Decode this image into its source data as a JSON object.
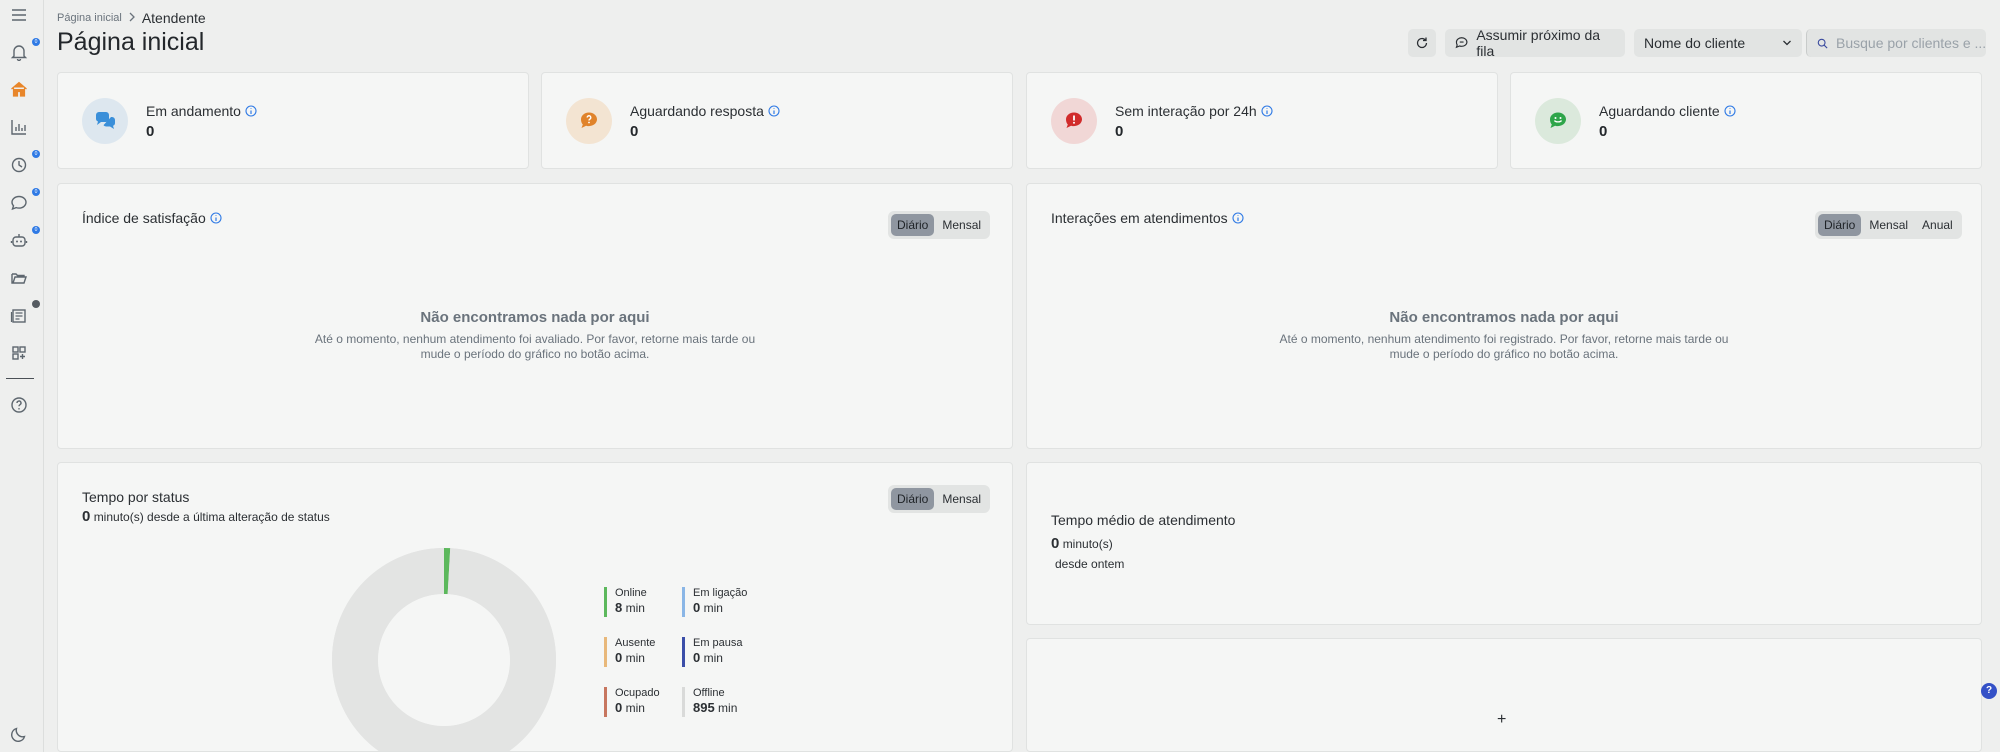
{
  "sidebar": {
    "items": [
      {
        "icon": "menu-icon"
      },
      {
        "icon": "bell-icon",
        "badge": "0"
      },
      {
        "icon": "home-icon",
        "active": true
      },
      {
        "icon": "chart-icon"
      },
      {
        "icon": "clock-icon",
        "badge": "0"
      },
      {
        "icon": "chat-icon",
        "badge": "0"
      },
      {
        "icon": "bot-icon",
        "badge": "0"
      },
      {
        "icon": "folder-icon"
      },
      {
        "icon": "news-icon"
      },
      {
        "icon": "apps-icon"
      },
      {
        "icon": "help-icon"
      },
      {
        "icon": "moon-icon"
      }
    ]
  },
  "breadcrumb": {
    "home": "Página inicial",
    "current": "Atendente"
  },
  "page_title": "Página inicial",
  "actions": {
    "next_in_queue": "Assumir próximo da fila",
    "filter_selected": "Nome do cliente",
    "search_placeholder": "Busque por clientes e ..."
  },
  "stats": [
    {
      "label": "Em andamento",
      "value": "0",
      "icon": "chat-bubbles-icon",
      "color": "#3a8fd9",
      "bg": "#dde7ef"
    },
    {
      "label": "Aguardando resposta",
      "value": "0",
      "icon": "question-bubble-icon",
      "color": "#e0832b",
      "bg": "#f3e4d2"
    },
    {
      "label": "Sem interação por 24h",
      "value": "0",
      "icon": "alert-bubble-icon",
      "color": "#d12b2b",
      "bg": "#f1d7d6"
    },
    {
      "label": "Aguardando cliente",
      "value": "0",
      "icon": "smile-bubble-icon",
      "color": "#2ea54a",
      "bg": "#dbe9dc"
    }
  ],
  "satisfaction": {
    "title": "Índice de satisfação",
    "tabs": [
      "Diário",
      "Mensal"
    ],
    "empty_title": "Não encontramos nada por aqui",
    "empty_line1": "Até o momento, nenhum atendimento foi avaliado. Por favor, retorne mais tarde ou",
    "empty_line2": "mude o período do gráfico no botão acima."
  },
  "interactions": {
    "title": "Interações em atendimentos",
    "tabs": [
      "Diário",
      "Mensal",
      "Anual"
    ],
    "empty_title": "Não encontramos nada por aqui",
    "empty_line1": "Até o momento, nenhum atendimento foi registrado. Por favor, retorne mais tarde ou",
    "empty_line2": "mude o período do gráfico no botão acima."
  },
  "status_time": {
    "title": "Tempo por status",
    "value": "0",
    "subtitle": "minuto(s) desde a última alteração de status",
    "tabs": [
      "Diário",
      "Mensal"
    ],
    "unit": "min",
    "legend": [
      {
        "name": "Online",
        "value": "8",
        "color": "#5cb85c"
      },
      {
        "name": "Em ligação",
        "value": "0",
        "color": "#8ab6e6"
      },
      {
        "name": "Ausente",
        "value": "0",
        "color": "#e8b87a"
      },
      {
        "name": "Em pausa",
        "value": "0",
        "color": "#3b4ea8"
      },
      {
        "name": "Ocupado",
        "value": "0",
        "color": "#c7765f"
      },
      {
        "name": "Offline",
        "value": "895",
        "color": "#e3e4e3"
      }
    ]
  },
  "avg_time": {
    "title": "Tempo médio de atendimento",
    "value": "0",
    "unit": "minuto(s)",
    "since": "desde ontem"
  },
  "add_widget": "+",
  "help_fab": "?",
  "chart_data": {
    "type": "pie",
    "categories": [
      "Online",
      "Em ligação",
      "Ausente",
      "Em pausa",
      "Ocupado",
      "Offline"
    ],
    "values": [
      8,
      0,
      0,
      0,
      0,
      895
    ],
    "title": "Tempo por status"
  }
}
